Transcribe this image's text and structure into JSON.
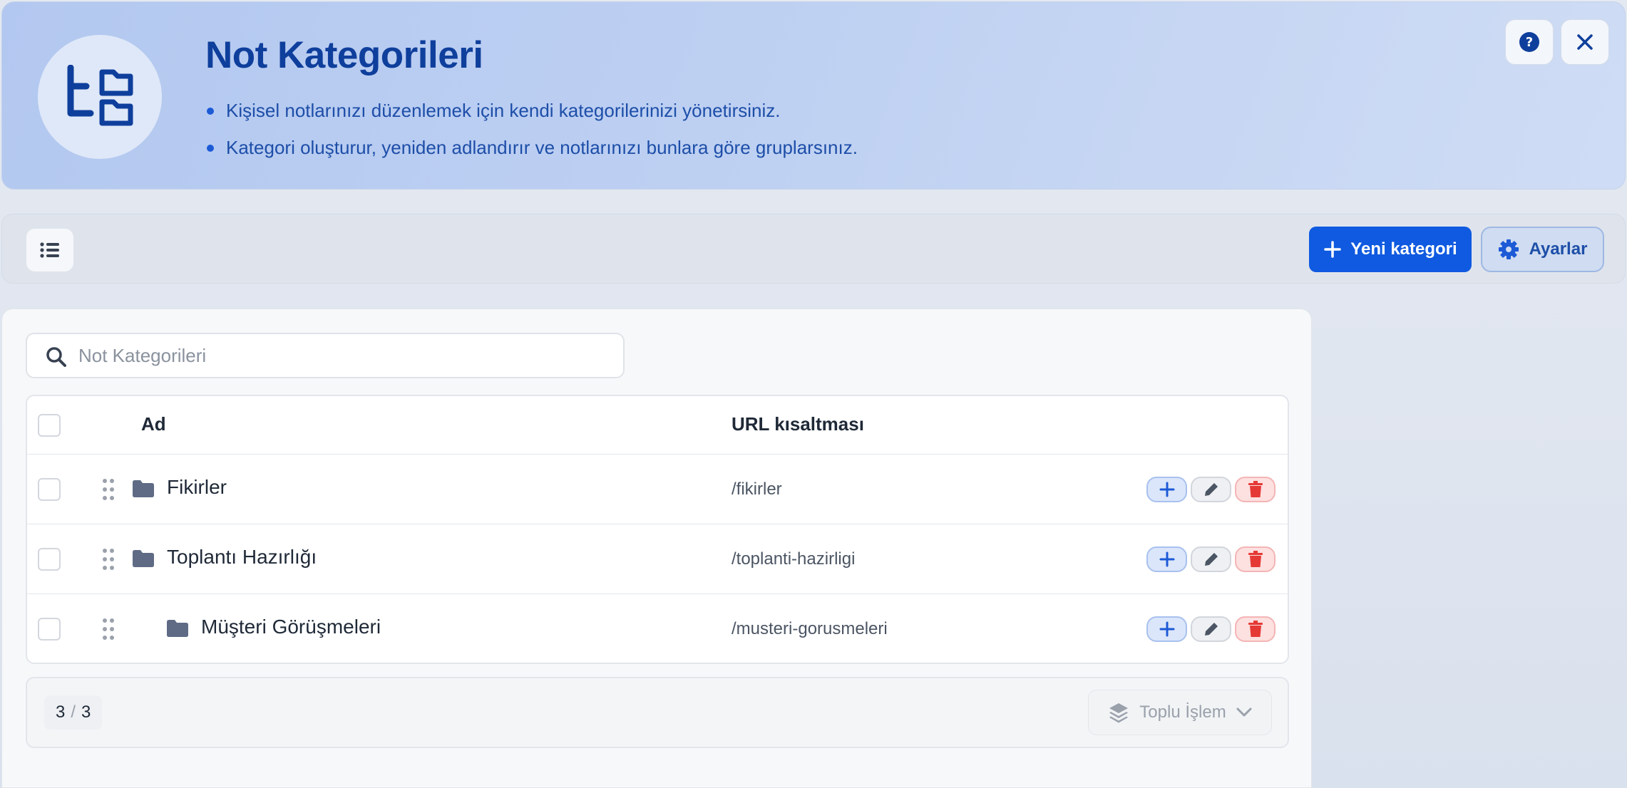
{
  "header": {
    "title": "Not Kategorileri",
    "bullets": [
      "Kişisel notlarınızı düzenlemek için kendi kategorilerinizi yönetirsiniz.",
      "Kategori oluşturur, yeniden adlandırır ve notlarınızı bunlara göre gruplarsınız."
    ],
    "icons": {
      "avatar": "tree-folders-icon",
      "help": "question-circle-icon",
      "close": "close-icon"
    }
  },
  "toolbar": {
    "list_icon": "list-icon",
    "new_label": "Yeni kategori",
    "settings_label": "Ayarlar"
  },
  "search": {
    "placeholder": "Not Kategorileri",
    "value": ""
  },
  "table": {
    "columns": {
      "name": "Ad",
      "slug": "URL kısaltması"
    },
    "rows": [
      {
        "name": "Fikirler",
        "slug": "/fikirler",
        "depth": 0
      },
      {
        "name": "Toplantı Hazırlığı",
        "slug": "/toplanti-hazirligi",
        "depth": 0
      },
      {
        "name": "Müşteri Görüşmeleri",
        "slug": "/musteri-gorusmeleri",
        "depth": 1
      }
    ]
  },
  "footer": {
    "shown": "3",
    "separator": "/",
    "total": "3",
    "bulk_label": "Toplu İşlem"
  },
  "colors": {
    "primary": "#0f5ae0",
    "title": "#0f3f9c",
    "danger": "#e53935",
    "folder": "#5f6b85"
  }
}
